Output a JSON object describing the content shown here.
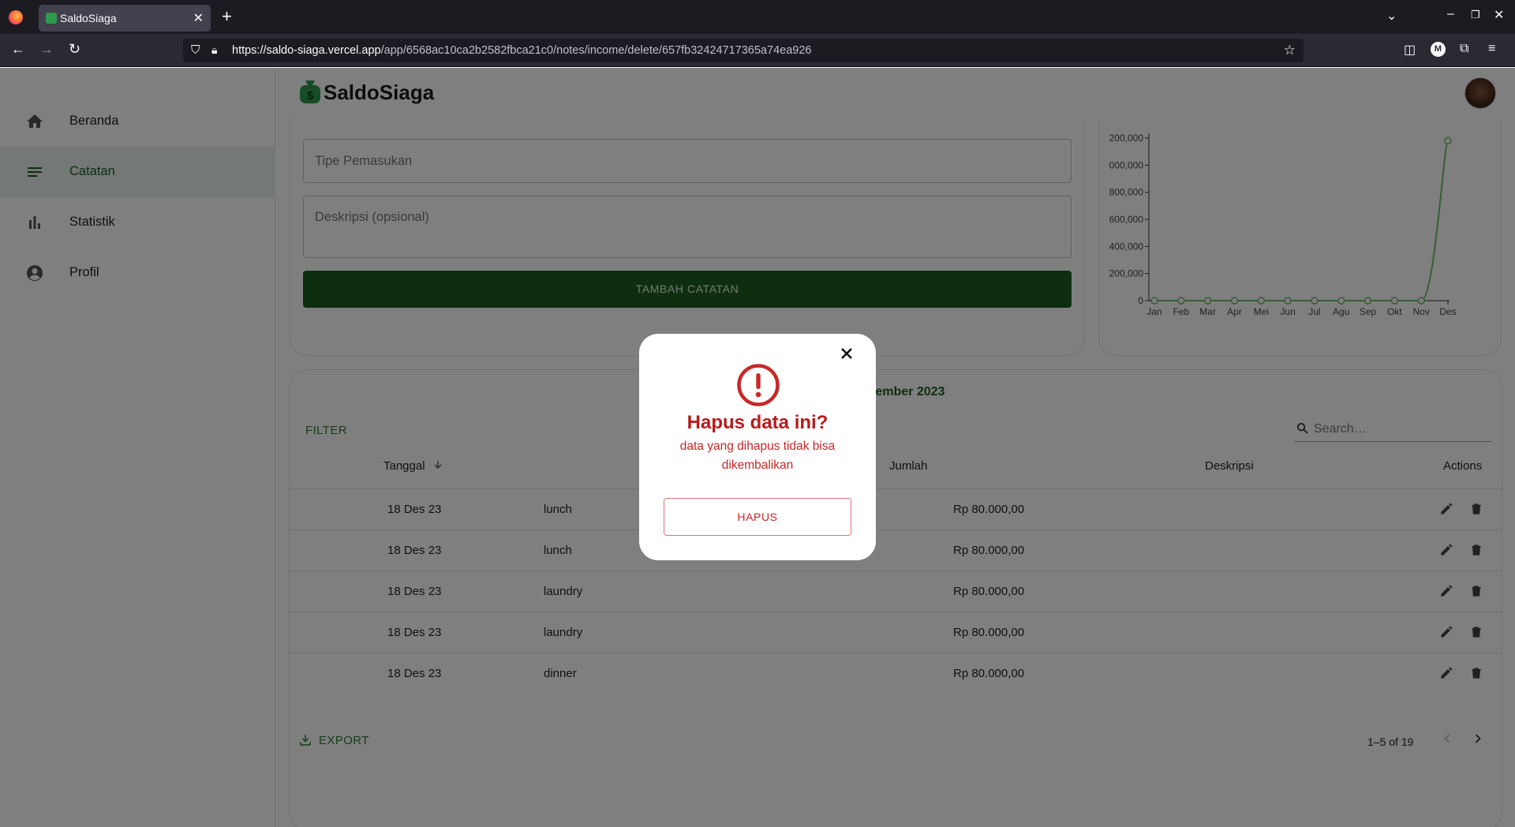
{
  "browser": {
    "tab_title": "SaldoSiaga",
    "url_host": "https://saldo-siaga.vercel.app",
    "url_path": "/app/6568ac10ca2b2582fbca21c0/notes/income/delete/657fb32424717365a74ea926",
    "profile_initial": "M"
  },
  "app": {
    "name": "SaldoSiaga"
  },
  "sidebar": {
    "items": [
      {
        "label": "Beranda",
        "icon": "home-icon"
      },
      {
        "label": "Catatan",
        "icon": "notes-icon",
        "active": true
      },
      {
        "label": "Statistik",
        "icon": "bar-chart-icon"
      },
      {
        "label": "Profil",
        "icon": "account-circle-icon"
      }
    ]
  },
  "form": {
    "tipe_placeholder": "Tipe Pemasukan",
    "deskripsi_placeholder": "Deskripsi (opsional)",
    "submit_label": "TAMBAH CATATAN"
  },
  "chart_data": {
    "type": "line",
    "categories": [
      "Jan",
      "Feb",
      "Mar",
      "Apr",
      "Mei",
      "Jun",
      "Jul",
      "Agu",
      "Sep",
      "Okt",
      "Nov",
      "Des"
    ],
    "values": [
      0,
      0,
      0,
      0,
      0,
      0,
      0,
      0,
      0,
      0,
      0,
      1180000
    ],
    "y_ticks": [
      "0",
      "200,000",
      "400,000",
      "600,000",
      "800,000",
      "000,000",
      "200,000"
    ],
    "y_tick_values": [
      0,
      200000,
      400000,
      600000,
      800000,
      1000000,
      1200000
    ],
    "ylim": [
      0,
      1200000
    ],
    "line_color": "#6abf69"
  },
  "table": {
    "title": "Desember 2023",
    "filter_label": "FILTER",
    "search_placeholder": "Search…",
    "columns": [
      "Tanggal",
      "Jumlah",
      "Deskripsi",
      "Actions"
    ],
    "rows": [
      {
        "tanggal": "18 Des 23",
        "tipe": "lunch",
        "jumlah": "Rp 80.000,00"
      },
      {
        "tanggal": "18 Des 23",
        "tipe": "lunch",
        "jumlah": "Rp 80.000,00"
      },
      {
        "tanggal": "18 Des 23",
        "tipe": "laundry",
        "jumlah": "Rp 80.000,00"
      },
      {
        "tanggal": "18 Des 23",
        "tipe": "laundry",
        "jumlah": "Rp 80.000,00"
      },
      {
        "tanggal": "18 Des 23",
        "tipe": "dinner",
        "jumlah": "Rp 80.000,00"
      }
    ],
    "export_label": "EXPORT",
    "pagination": "1–5 of 19"
  },
  "modal": {
    "title": "Hapus data ini?",
    "message": "data yang dihapus tidak bisa dikembalikan",
    "confirm_label": "HAPUS",
    "accent": "#c62828"
  }
}
